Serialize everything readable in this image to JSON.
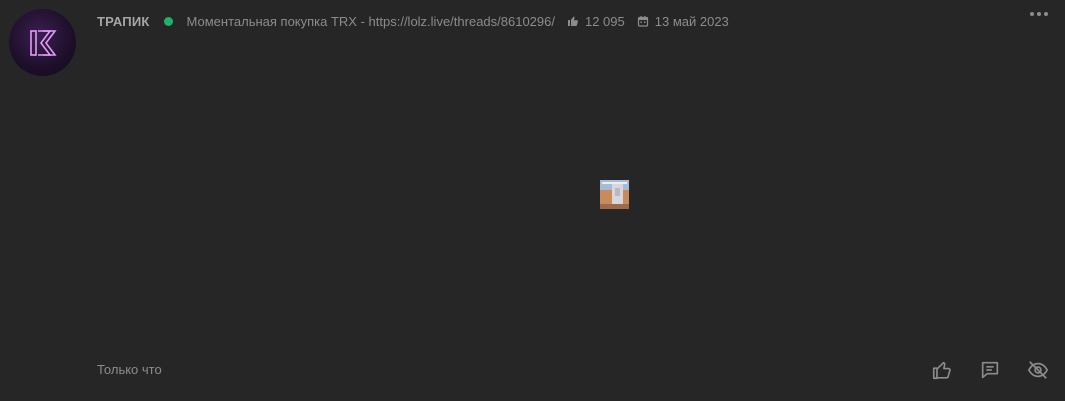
{
  "post": {
    "author": "ТРАПИК",
    "status_message": "Моментальная покупка TRX - https://lolz.live/threads/8610296/",
    "likes_count": "12 095",
    "register_date": "13 май 2023",
    "time": "Только что"
  },
  "colors": {
    "background": "#262626",
    "online": "#1fb26a",
    "text": "#8c8c8c",
    "avatar_accent": "#d98cf0"
  },
  "icons": {
    "likes": "thumbs-up-icon",
    "date": "calendar-icon",
    "menu": "more-dots-icon",
    "like_action": "like-icon",
    "comment_action": "comment-icon",
    "hide_action": "eye-off-icon"
  }
}
